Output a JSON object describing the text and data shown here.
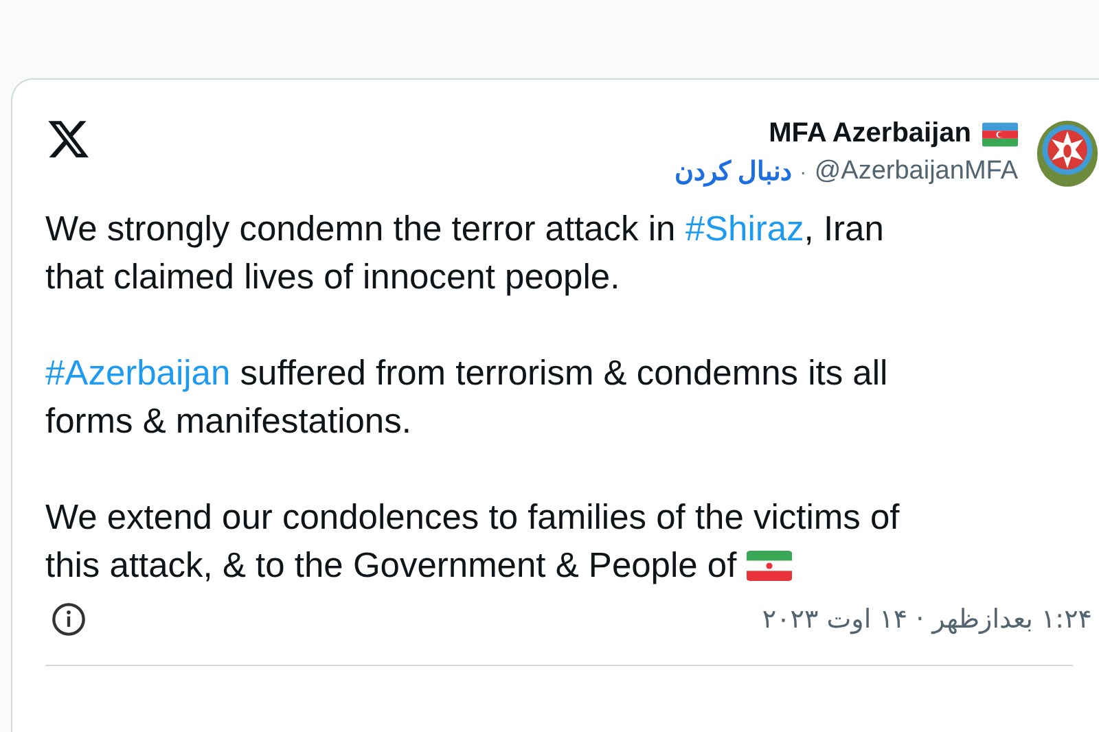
{
  "author": {
    "name": "MFA Azerbaijan",
    "handle": "@AzerbaijanMFA",
    "separator": "·",
    "follow_label": "دنبال کردن"
  },
  "paragraphs": [
    [
      [
        {
          "kind": "text",
          "text": "We strongly condemn the terror attack in "
        },
        {
          "kind": "hashtag",
          "text": "#Shiraz"
        },
        {
          "kind": "text",
          "text": ", Iran"
        }
      ],
      [
        {
          "kind": "text",
          "text": "that claimed lives of innocent people."
        }
      ]
    ],
    [
      [
        {
          "kind": "hashtag",
          "text": "#Azerbaijan"
        },
        {
          "kind": "text",
          "text": " suffered from terrorism & condemns its all"
        }
      ],
      [
        {
          "kind": "text",
          "text": "forms & manifestations."
        }
      ]
    ],
    [
      [
        {
          "kind": "text",
          "text": "We extend our condolences to families of the victims of"
        }
      ],
      [
        {
          "kind": "text",
          "text": "this attack, & to the Government & People of "
        },
        {
          "kind": "flag"
        }
      ]
    ]
  ],
  "timestamp": "۱:۲۴ بعدازظهر · ۱۴ اوت ۲۰۲۳"
}
